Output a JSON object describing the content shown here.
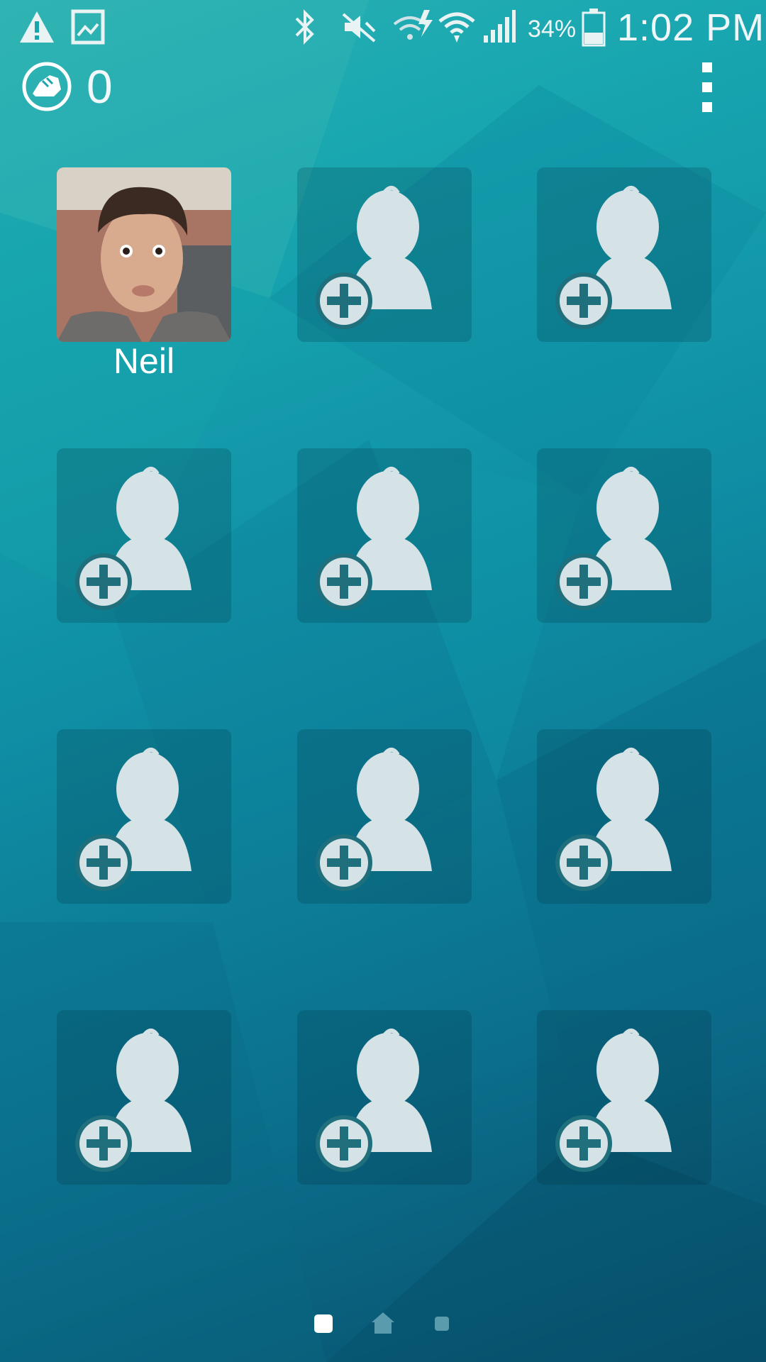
{
  "status_bar": {
    "icons": [
      "alert-icon",
      "gallery-icon",
      "bluetooth-icon",
      "vibrate-mute-icon",
      "wifi-calling-icon",
      "wifi-icon",
      "signal-icon",
      "battery-icon"
    ],
    "battery_percent": "34%",
    "time": "1:02 PM"
  },
  "app_bar": {
    "step_icon": "shoe-icon",
    "step_count": "0",
    "menu_icon": "overflow-menu-icon"
  },
  "contacts": {
    "filled": [
      {
        "name": "Neil"
      }
    ],
    "empty_slot_count": 11,
    "empty_slot_icon": "add-contact-icon"
  },
  "page_indicator": {
    "items": [
      "page-dot",
      "home-icon",
      "page-dot"
    ],
    "active_index": 0
  },
  "colors": {
    "background_top": "#2bb2b4",
    "background_bottom": "#084f6b",
    "placeholder_icon": "#d5e2e6",
    "placeholder_plus": "#1f6f7c"
  }
}
